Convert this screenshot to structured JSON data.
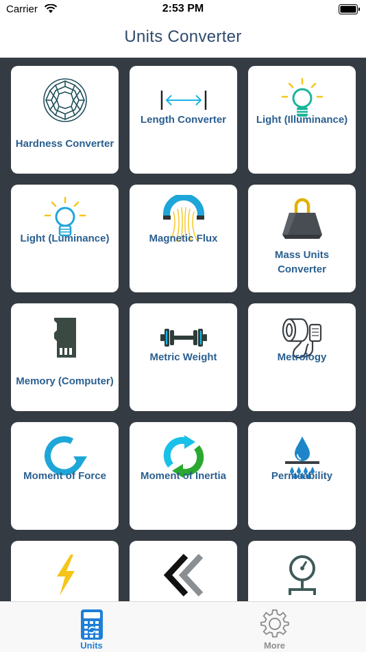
{
  "status": {
    "carrier": "Carrier",
    "time": "2:53 PM"
  },
  "nav": {
    "title": "Units Converter"
  },
  "tiles": [
    {
      "label": "Hardness Converter",
      "icon": "diamond-icon"
    },
    {
      "label": "Length Converter",
      "icon": "length-arrows-icon"
    },
    {
      "label": "Light (Illuminance)",
      "icon": "lightbulb-green-icon"
    },
    {
      "label": "Light (Luminance)",
      "icon": "lightbulb-blue-icon"
    },
    {
      "label": "Magnetic Flux",
      "icon": "magnet-icon"
    },
    {
      "label": "Mass Units Converter",
      "icon": "weight-icon"
    },
    {
      "label": "Memory (Computer)",
      "icon": "sd-card-icon"
    },
    {
      "label": "Metric Weight",
      "icon": "dumbbell-icon"
    },
    {
      "label": "Metrology",
      "icon": "tape-measure-icon"
    },
    {
      "label": "Moment of Force",
      "icon": "rotate-arrow-icon"
    },
    {
      "label": "Moment of Inertia",
      "icon": "cycle-arrows-icon"
    },
    {
      "label": "Permeability",
      "icon": "water-drop-icon"
    },
    {
      "label": "",
      "icon": "lightning-icon"
    },
    {
      "label": "",
      "icon": "double-chevron-left-icon"
    },
    {
      "label": "",
      "icon": "pressure-gauge-icon"
    }
  ],
  "tabs": [
    {
      "label": "Units",
      "icon": "calculator-icon",
      "active": true
    },
    {
      "label": "More",
      "icon": "gear-icon",
      "active": false
    }
  ],
  "colors": {
    "grid_background": "#353b42",
    "label_color": "#2a5f8f",
    "nav_title_color": "#2f4a6e",
    "tab_active": "#1e7fd6",
    "tab_inactive": "#8e8e93"
  }
}
